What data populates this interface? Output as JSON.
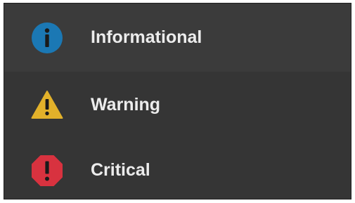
{
  "menu": {
    "items": [
      {
        "label": "Informational",
        "icon": "info-icon",
        "color": "#1b78b4",
        "selected": true
      },
      {
        "label": "Warning",
        "icon": "warning-icon",
        "color": "#e2b12a",
        "selected": false
      },
      {
        "label": "Critical",
        "icon": "critical-icon",
        "color": "#d8323f",
        "selected": false
      }
    ]
  }
}
